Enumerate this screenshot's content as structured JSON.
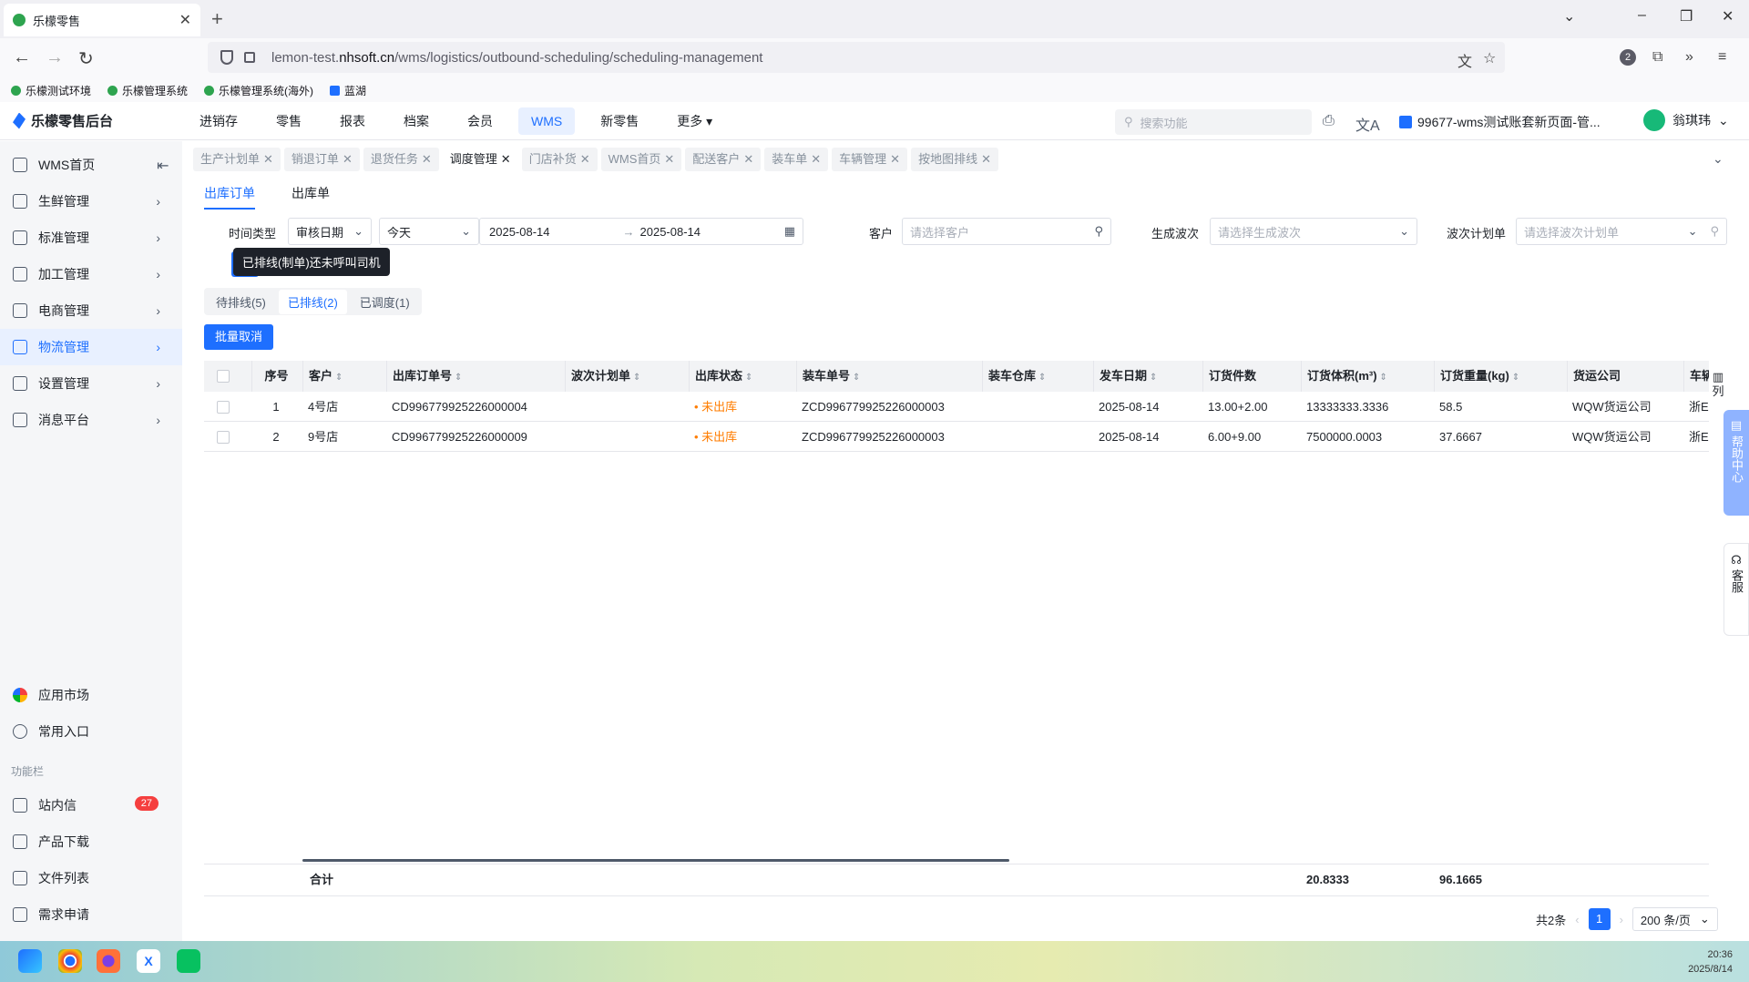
{
  "browser": {
    "tab_title": "乐檬零售",
    "url_prefix": "lemon-test.",
    "url_host": "nhsoft.cn",
    "url_path": "/wms/logistics/outbound-scheduling/scheduling-management",
    "badge_count": "2",
    "bookmarks": [
      "乐檬测试环境",
      "乐檬管理系统",
      "乐檬管理系统(海外)",
      "蓝湖"
    ]
  },
  "app": {
    "logo_text": "乐檬零售后台",
    "nav": [
      "进销存",
      "零售",
      "报表",
      "档案",
      "会员",
      "WMS",
      "新零售",
      "更多"
    ],
    "active_nav": "WMS",
    "search_placeholder": "搜索功能",
    "account": "99677-wms测试账套新页面-管...",
    "user": "翁琪玮"
  },
  "sidebar": {
    "items": [
      {
        "label": "WMS首页"
      },
      {
        "label": "生鲜管理"
      },
      {
        "label": "标准管理"
      },
      {
        "label": "加工管理"
      },
      {
        "label": "电商管理"
      },
      {
        "label": "物流管理"
      },
      {
        "label": "设置管理"
      },
      {
        "label": "消息平台"
      }
    ],
    "bottom": [
      {
        "label": "应用市场"
      },
      {
        "label": "常用入口"
      }
    ],
    "section_label": "功能栏",
    "tools": [
      {
        "label": "站内信",
        "badge": "27"
      },
      {
        "label": "产品下载"
      },
      {
        "label": "文件列表"
      },
      {
        "label": "需求申请"
      }
    ]
  },
  "page_tabs": [
    "生产计划单",
    "销退订单",
    "退货任务",
    "调度管理",
    "门店补货",
    "WMS首页",
    "配送客户",
    "装车单",
    "车辆管理",
    "按地图排线"
  ],
  "active_page_tab": "调度管理",
  "sub_tabs": [
    "出库订单",
    "出库单"
  ],
  "filters": {
    "time_type_label": "时间类型",
    "time_type_value": "审核日期",
    "range_value": "今天",
    "date_from": "2025-08-14",
    "date_arrow": "→",
    "date_to": "2025-08-14",
    "customer_label": "客户",
    "customer_placeholder": "请选择客户",
    "wave_label": "生成波次",
    "wave_placeholder": "请选择生成波次",
    "plan_label": "波次计划单",
    "plan_placeholder": "请选择波次计划单"
  },
  "tooltip": "已排线(制单)还未呼叫司机",
  "status_tabs": [
    "待排线(5)",
    "已排线(2)",
    "已调度(1)"
  ],
  "batch_cancel": "批量取消",
  "table": {
    "columns": [
      "序号",
      "客户",
      "出库订单号",
      "波次计划单",
      "出库状态",
      "装车单号",
      "装车仓库",
      "发车日期",
      "订货件数",
      "订货体积(m³)",
      "订货重量(kg)",
      "货运公司",
      "车辆"
    ],
    "rows": [
      {
        "seq": "1",
        "customer": "4号店",
        "order_no": "CD996779925226000004",
        "wave_plan": "",
        "status": "未出库",
        "load_no": "ZCD996779925226000003",
        "warehouse": "",
        "date": "2025-08-14",
        "qty": "13.00+2.00",
        "volume": "13333333.3336",
        "weight": "58.5",
        "carrier": "WQW货运公司",
        "vehicle": "浙E"
      },
      {
        "seq": "2",
        "customer": "9号店",
        "order_no": "CD996779925226000009",
        "wave_plan": "",
        "status": "未出库",
        "load_no": "ZCD996779925226000003",
        "warehouse": "",
        "date": "2025-08-14",
        "qty": "6.00+9.00",
        "volume": "7500000.0003",
        "weight": "37.6667",
        "carrier": "WQW货运公司",
        "vehicle": "浙E"
      }
    ],
    "summary_label": "合计",
    "summary_volume": "20.8333",
    "summary_weight": "96.1665"
  },
  "column_setting": "列",
  "pager": {
    "total": "共2条",
    "page": "1",
    "size": "200 条/页"
  },
  "help_center": "帮助中心",
  "customer_service": "客服",
  "clock": {
    "time": "20:36",
    "date": "2025/8/14"
  },
  "colors": {
    "primary": "#1e6fff",
    "warning": "#ff7d00",
    "danger": "#f53f3f"
  }
}
